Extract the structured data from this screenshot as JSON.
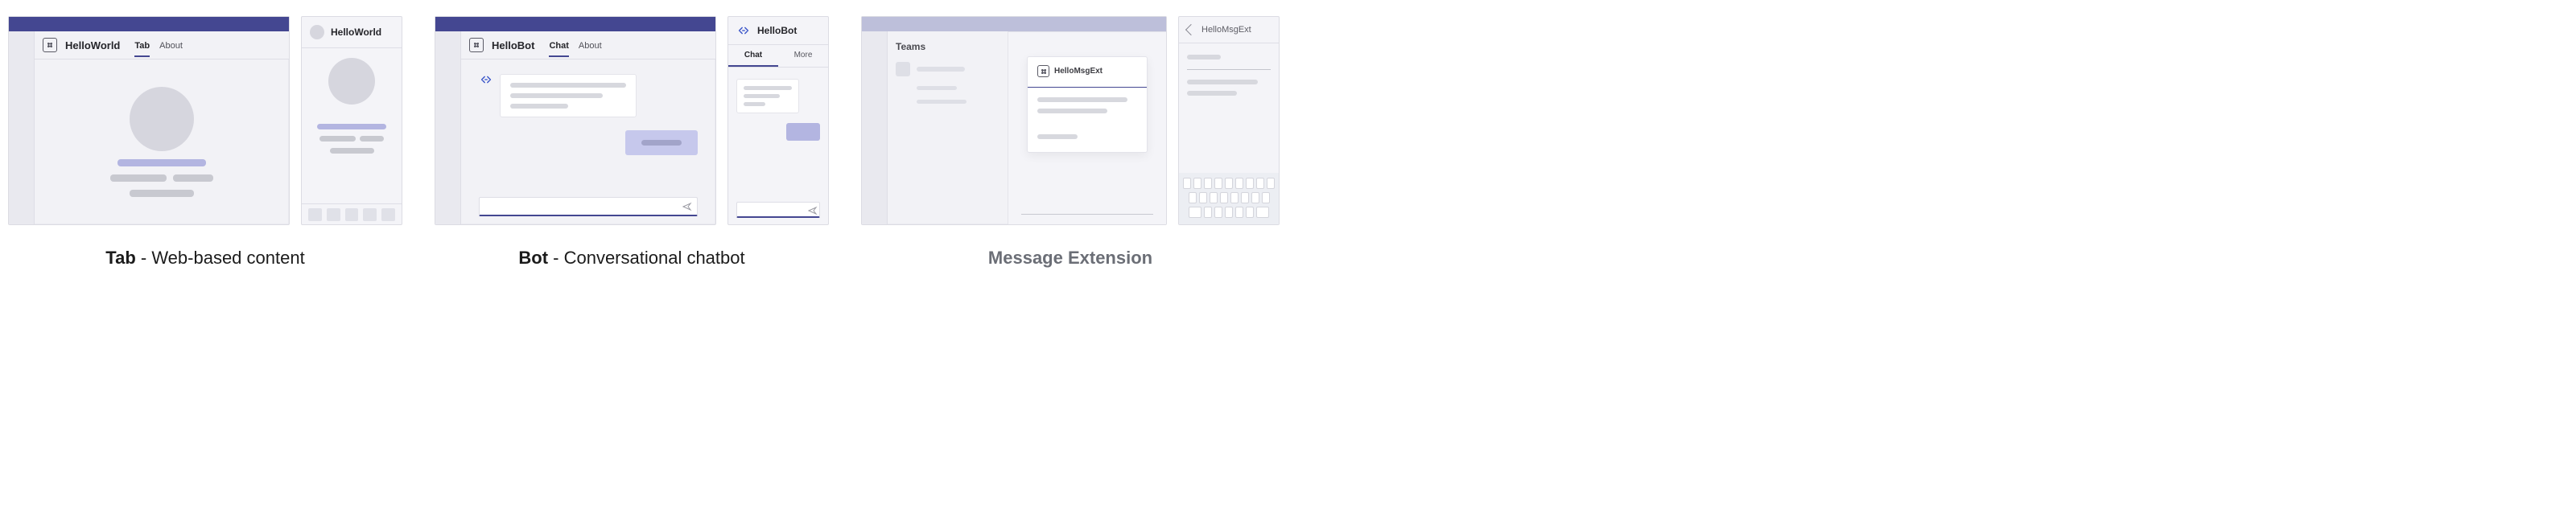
{
  "tab": {
    "desktop": {
      "app_title": "HelloWorld",
      "tabs": [
        {
          "label": "Tab",
          "active": true
        },
        {
          "label": "About",
          "active": false
        }
      ]
    },
    "mobile": {
      "title": "HelloWorld"
    },
    "caption_bold": "Tab",
    "caption_rest": " - Web-based content"
  },
  "bot": {
    "desktop": {
      "app_title": "HelloBot",
      "tabs": [
        {
          "label": "Chat",
          "active": true
        },
        {
          "label": "About",
          "active": false
        }
      ]
    },
    "mobile": {
      "title": "HelloBot",
      "tabs": [
        {
          "label": "Chat",
          "active": true
        },
        {
          "label": "More",
          "active": false
        }
      ]
    },
    "caption_bold": "Bot",
    "caption_rest": " - Conversational chatbot"
  },
  "msgext": {
    "desktop": {
      "teams_title": "Teams",
      "card_title": "HelloMsgExt"
    },
    "mobile": {
      "title": "HelloMsgExt"
    },
    "caption": "Message Extension"
  }
}
